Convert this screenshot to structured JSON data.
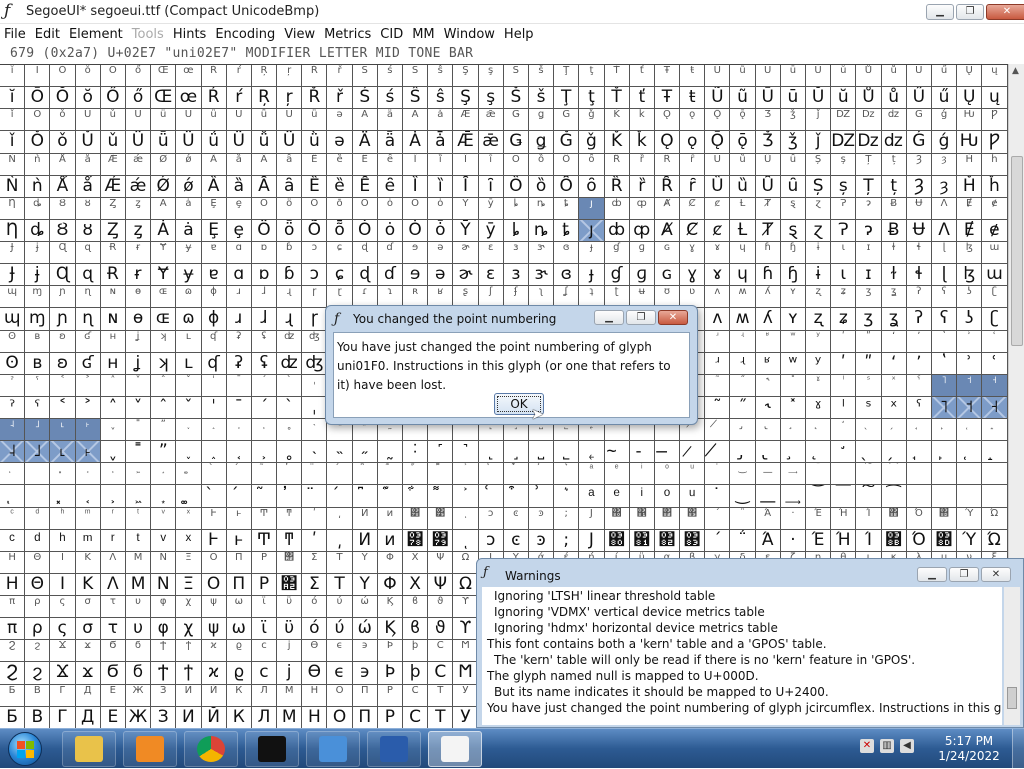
{
  "window": {
    "app_icon": "ƒ",
    "title": "SegoeUI*  segoeui.ttf (Compact UnicodeBmp)",
    "minimize_icon": "minimize-icon",
    "maximize_icon": "maximize-icon",
    "close_icon": "close-icon"
  },
  "menu": [
    "File",
    "Edit",
    "Element",
    "Tools",
    "Hints",
    "Encoding",
    "View",
    "Metrics",
    "CID",
    "MM",
    "Window",
    "Help"
  ],
  "menu_disabled": [
    "Tools"
  ],
  "glyph_info": "679 (0x2a7) U+02E7 \"uni02E7\" MODIFIER LETTER MID TONE BAR",
  "grid": {
    "columns": 40,
    "rows": [
      {
        "labels": "ĭĪŎŏŐőŒœŔŕŖŗŘřŚśŜŝŞşŠšŢţŤťŦŧŨũŪūŬŭŮůŰűŲųŴŵ",
        "glyphs": "ĭŌŎŏŐőŒœŔŕŖŗŘřŚśŜŝŞşŠšŢţŤťŦŧŨũŪūŬŭŮůŰűŲų"
      },
      {
        "labels": "ǐǑǒǓǔǕǖǗǘǙǚǛǜǝǞǟǠǡǢǣǤǥǦǧǨǩǪǫǬǭǮǯǰǱǲǳǴǵǶǷ",
        "glyphs": "ǐǑǒǓǔǕǖǗǘǙǚǛǜǝǞǟǠǡǢǣǤǥǦǧǨǩǪǫǬǭǮǯǰǱǲǳǴǵǶǷ"
      },
      {
        "labels": "ǸǹǺǻǼǽǾǿȀȁȂȃȄȅȆȇȈȉȊȋȌȍȎȏȐȑȒȓȔȕȖȗȘșȚțȜȝȞȟ",
        "glyphs": "ǸǹǺǻǼǽǾǿȀȁȂȃȄȅȆȇȈȉȊȋȌȍȎȏȐȑȒȓȔȕȖȗȘșȚțȜȝȞȟ"
      },
      {
        "labels": "ȠȡȢȣȤȥȦȧȨȩȪȫȬȭȮȯȰȱȲȳȴȵȶȷȸȹȺȻȼȽȾȿɀɁɂɃɄɅɆɇ",
        "glyphs": "ȠȡȢȣȤȥȦȧȨȩȪȫȬȭȮȯȰȱȲȳȴȵȶȷȸȹȺȻȼȽȾȿɀɁɂɃɄɅɆɇ"
      },
      {
        "labels": "ɈɉɊɋɌɍɎɏɐɑɒɓɔɕɖɗɘəɚɛɜɝɞɟɠɡɢɣɤɥɦɧɨɩɪɫɬɭɮɯ",
        "glyphs": "ɈɉɊɋɌɍɎɏɐɑɒɓɔɕɖɗɘəɚɛɜɝɞɟɠɡɢɣɤɥɦɧɨɩɪɫɬɭɮɯ"
      },
      {
        "labels": "ɰɱɲɳɴɵɶɷɸɹɺɻɼɽɾɿʀʁʂʃʄʅʆʇʈʉʊʋʌʍʎʏʐʑʒʓʔʕʖʗ",
        "glyphs": "ɰɱɲɳɴɵɶɷɸɹɺɻɼɽɾɿʀʁʂʃʄʅʆʇʈʉʊʋʌʍʎʏʐʑʒʓʔʕʖʗ"
      },
      {
        "labels": "ʘʙʚʛʜʝʞʟʠʡʢʣʤʥʦʧʨʩʪʫʬʭʮʯʰʱʲʳʴʵʶʷʸʹʺʻʼʽʾʿ",
        "glyphs": "ʘʙʚʛʜʝʞʟʠʡʢʣʤʥʦʧʨʩʪʫʬʭʮʯʰʱʲʳʴʵʶʷʸʹʺʻʼʽʾʿ"
      },
      {
        "labels": "ˀˁ˂˃˄˅ˆˇˈˉˊˋˌˍˎˏːˑ˒˓˔˕˖˗˘˙˚˛˜˝˞˟ˠˡˢˣˤ˥˦˧",
        "glyphs": "ˀˁ˂˃˄˅ˆˇˈˉˊˋˌˍˎˏːˑ˒˓˔˕˖˗˘˙˚˛˜˝˞˟ˠˡˢˣˤ˥˦˧"
      },
      {
        "labels": "˨˩˪˫ˬ˭ˮ˯˰˱˲˳˴˵˶˷˸˹˺˻˼˽˾˿̴̵̶̷̸̡̢̧̨̛̖̗̘̙̜̝̞̟̠̣̤̥̦̩̪̫̬̭̮̯̀́̂̃̄̅̆̇̈̉̊̋̌̍̎̏̐̑̒̓̔̽̾̿̕̚",
        "glyphs": "˨˩˪˫ˬ˭ˮ˯˰˱˲˳˴˵˶˷˸˹˺˻˼˽˾˿̴̵̶̷̸̡̢̧̨̛̖̗̘̙̜̝̞̟̠̣̤̥̦̩̪̫̬̭̮̯̀́̂̃̄̅̆̇̈̉̊̋̌̍̎̏̐̑̒̓̔̽̾̿̕̚"
      },
      {
        "labels": "ͅ͏͓͔͕͖͙͚̀́͂̓̈́͆͊͋͌͐͑͒͗͛ͣͤͥͦͧ͘͜͟͢͝͞͠͡",
        "glyphs": "ͅ͏͓͔͕͖͙͚̀́͂̓̈́͆͊͋͌͐͑͒͗͛ͣͤͥͦͧ͘͜͟͢͝͞͠͡"
      },
      {
        "labels": "ͨͩͪͫͬͭͮͯͰͱͲͳʹ͵Ͷͷ͸͹ͺͻͼͽ;Ϳ΀΁΂΃΄΅Ά·ΈΉΊ΋Ό΍ΎΏ",
        "glyphs": "ͨͩͪͫͬͭͮͯͰͱͲͳʹ͵Ͷͷ͸͹ͺͻͼͽ;Ϳ΀΁΂΃΄΅Ά·ΈΉΊ΋Ό΍ΎΏ"
      },
      {
        "labels": "ΗΘΙΚΛΜΝΞΟΠΡ΢ΣΤΥΦΧΨΩΪΫάέήίΰαβγδεζηθικλμνξ",
        "glyphs": "ΗΘΙΚΛΜΝΞΟΠΡ΢ΣΤΥΦΧΨΩΪΫάέήίΰαβγδεζηθικλμνξ"
      },
      {
        "labels": "πρςστυφχψωϊϋόύώϏϐϑϒϓϔϕϖϗϘϙϚϛϜϝϞϟϠϡϢϣϤϥϦϧ",
        "glyphs": "πρςστυφχψωϊϋόύώϏϐϑϒϓϔϕϖϗϘϙϚϛϜϝϞϟϠϡϢϣϤϥϦϧ"
      },
      {
        "labels": "ϨϩϪϫϬϭϮϯϰϱϲϳϴϵ϶ϷϸϹϺϻϼϽϾϿЀЁЂЃЄЅІЇЈЉЊЋЌЍЎЏ",
        "glyphs": "ϨϩϪϫϬϭϮϯϰϱϲϳϴϵ϶ϷϸϹϺϻϼϽϾϿЀЁЂЃЄЅІЇЈЉЊЋЌЍЎЏ"
      },
      {
        "labels": "БВГДЕЖЗИЙКЛМНОПРСТУФХЦЧШЩЪЫЬЭЮЯабвгдежзи",
        "glyphs": "БВГДЕЖЗИЙКЛМНОПРСТУФХЦЧШЩЪЫЬЭЮЯабвгдежзи"
      }
    ]
  },
  "dialog": {
    "icon": "ƒ",
    "title": "You changed the point numbering",
    "message": "You have just changed the point numbering of glyph uni01F0. Instructions in this glyph (or one that refers to it) have been lost.",
    "ok_label": "OK",
    "cursor_icon": "arrow-cursor-icon"
  },
  "warnings": {
    "icon": "ƒ",
    "title": "Warnings",
    "lines": [
      {
        "text": "Ignoring 'LTSH' linear threshold table",
        "indent": 1
      },
      {
        "text": "Ignoring 'VDMX' vertical device metrics table",
        "indent": 1
      },
      {
        "text": "Ignoring 'hdmx' horizontal device metrics table",
        "indent": 1
      },
      {
        "text": "This font contains both a 'kern' table and a 'GPOS' table.",
        "indent": 0
      },
      {
        "text": "The 'kern' table will only be read if there is no 'kern' feature in 'GPOS'.",
        "indent": 1
      },
      {
        "text": "The glyph named null is mapped to U+000D.",
        "indent": 0
      },
      {
        "text": "But its name indicates it should be mapped to U+2400.",
        "indent": 1
      },
      {
        "text": "You have just changed the point numbering of glyph jcircumflex. Instructions in this glyph",
        "indent": 0
      }
    ]
  },
  "taskbar": {
    "apps": [
      {
        "name": "explorer",
        "color": "#e9c24a",
        "active": false
      },
      {
        "name": "media-player",
        "color": "#f08a24",
        "active": false
      },
      {
        "name": "chrome",
        "color": "#db4437",
        "active": false
      },
      {
        "name": "command-prompt",
        "color": "#111111",
        "active": false
      },
      {
        "name": "control-panel",
        "color": "#4a90d9",
        "active": false
      },
      {
        "name": "powershell",
        "color": "#2a5cab",
        "active": false
      },
      {
        "name": "fontforge",
        "color": "#f4f4f4",
        "active": true
      }
    ],
    "time": "5:17 PM",
    "date": "1/24/2022"
  },
  "colors": {
    "highlight": "#6a88b4",
    "dialog_frame": "#c4d6ea",
    "taskbar": "#2d5b93"
  }
}
